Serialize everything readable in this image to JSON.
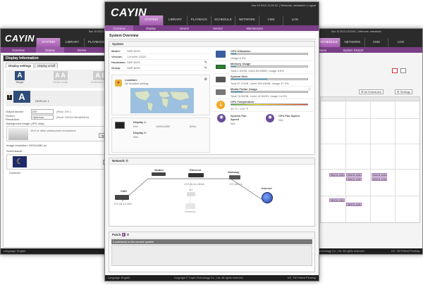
{
  "brand": "CAYIN",
  "left_window": {
    "time": "Nov 19 2013 11:26:22",
    "nav": [
      "SYSTEM",
      "LIBRARY",
      "PLAYBACK"
    ],
    "subnav": [
      "Overview",
      "Display",
      "Device"
    ],
    "section_title": "Display Information",
    "tabs": [
      "Display settings",
      "Display on/off"
    ],
    "modes": [
      "Single",
      "Clone mode",
      "Extended mode"
    ],
    "display_label": "DISPLAY 1",
    "output_device_label": "Output device:",
    "output_device_value": "DVI",
    "real_label": "(Real: DVI )",
    "screen_res_label": "Screen Resolution:",
    "screen_res_value": "Optimum",
    "real_res": "(Real: 1920x1080@60Hz)",
    "bg_label": "Background image (JPG only):",
    "bg_note1": "16:9 or other widescreen resolutions",
    "upload_label": "Upload",
    "img_res": "Image resolution: 1920x1080 px",
    "screensaver_label": "Screensaver:",
    "screensaver_value": "Content1",
    "edit_label": "Edit",
    "footer_lang": "Language:",
    "footer_lang_val": "English"
  },
  "right_window": {
    "time": "Nov 19 2013 19:20:52",
    "welcome": "Welcome, webadmin",
    "nav": [
      "SCHEDULE",
      "NETWORK",
      "CMS",
      "LOG"
    ],
    "subnav": [
      "Volume",
      "System Restart"
    ],
    "all_schedules": "All Schedules",
    "settings": "Settings",
    "events": [
      "WNCH-1118-1...",
      "WNCH-1118-1...",
      "WNCH-1118-1...",
      "WNCH-1118-1...",
      "WNCH-1118-1...",
      "WNCH-1118-1...",
      "WNCH-1118-1..."
    ],
    "footer_copy": "Cayin Technology Co., Ltd. All rights reserved.",
    "footer_patent": "US, TW Patent Pending"
  },
  "main_window": {
    "time": "Nov 19 2013 11:26:22",
    "welcome": "Welcome, webadmin",
    "logout": "Logout",
    "nav": [
      "SYSTEM",
      "LIBRARY",
      "PLAYBACK",
      "SCHEDULE",
      "NETWORK",
      "CMS",
      "LOG"
    ],
    "subnav": [
      "Overview",
      "Display",
      "Device",
      "Service",
      "Maintenance"
    ],
    "page_title": "System Overview",
    "system_title": "System",
    "model_label": "Model:",
    "model_value": "SMP-8000",
    "version_label": "Version:",
    "version_value": "1.8 build 13322",
    "hostname_label": "Hostname:",
    "hostname_value": "SMP-8000",
    "group_label": "Group:",
    "group_value": "SMP-8000",
    "location_label": "Location:",
    "location_value": "No location setting.",
    "display1_label": "Display 1:",
    "display1_type": "DVI",
    "display1_res": "1920x1080",
    "display1_hz": "60Hz",
    "display2_label": "Display 2:",
    "display2_value": "N/A",
    "metrics": {
      "cpu": {
        "label": "CPU Utilization",
        "text": "Usage 6.3%",
        "pct": 6.3
      },
      "memory": {
        "label": "Memory Usage",
        "text": "Total 1.03GB, Used 69.89MB, Usage 6.6%",
        "pct": 6.6
      },
      "disk": {
        "label": "System Disk",
        "text": "Total 87.29GB, Used 336.03MB, Usage 47.3%",
        "pct": 47.3
      },
      "media": {
        "label": "Media Folder Usage",
        "text": "Total 78.96GB, Used 10.94GB, Usage 14.5%",
        "pct": 14.5
      },
      "temp": {
        "label": "CPU Temperature",
        "text": "49 °C / 120 °F",
        "pct": 40
      }
    },
    "fan_label": "System Fan Speed",
    "fan_value": "N/A",
    "cpufan_label": "CPU Fan Speed",
    "cpufan_value": "N/A",
    "network_title": "Network",
    "nodes": {
      "switch": "Switch",
      "ethernet": "Ethernet",
      "eth_ip": "172.16.11.24/16",
      "gateway": "Gateway",
      "gw_ip": "172.16.0.1",
      "cms": "CMS",
      "cms_ip": "172.16.14.100",
      "internet": "Internet",
      "wifi": "3G",
      "wireless": "Wireless"
    },
    "patch_title": "Patch",
    "patch_badge": "0",
    "patch_msg": "0 patch(es) in the current system",
    "footer_lang": "Language:",
    "footer_lang_val": "English",
    "footer_copy": "Copyright © Cayin Technology Co., Ltd. All rights reserved.",
    "footer_patent": "US, TW Patent Pending"
  }
}
